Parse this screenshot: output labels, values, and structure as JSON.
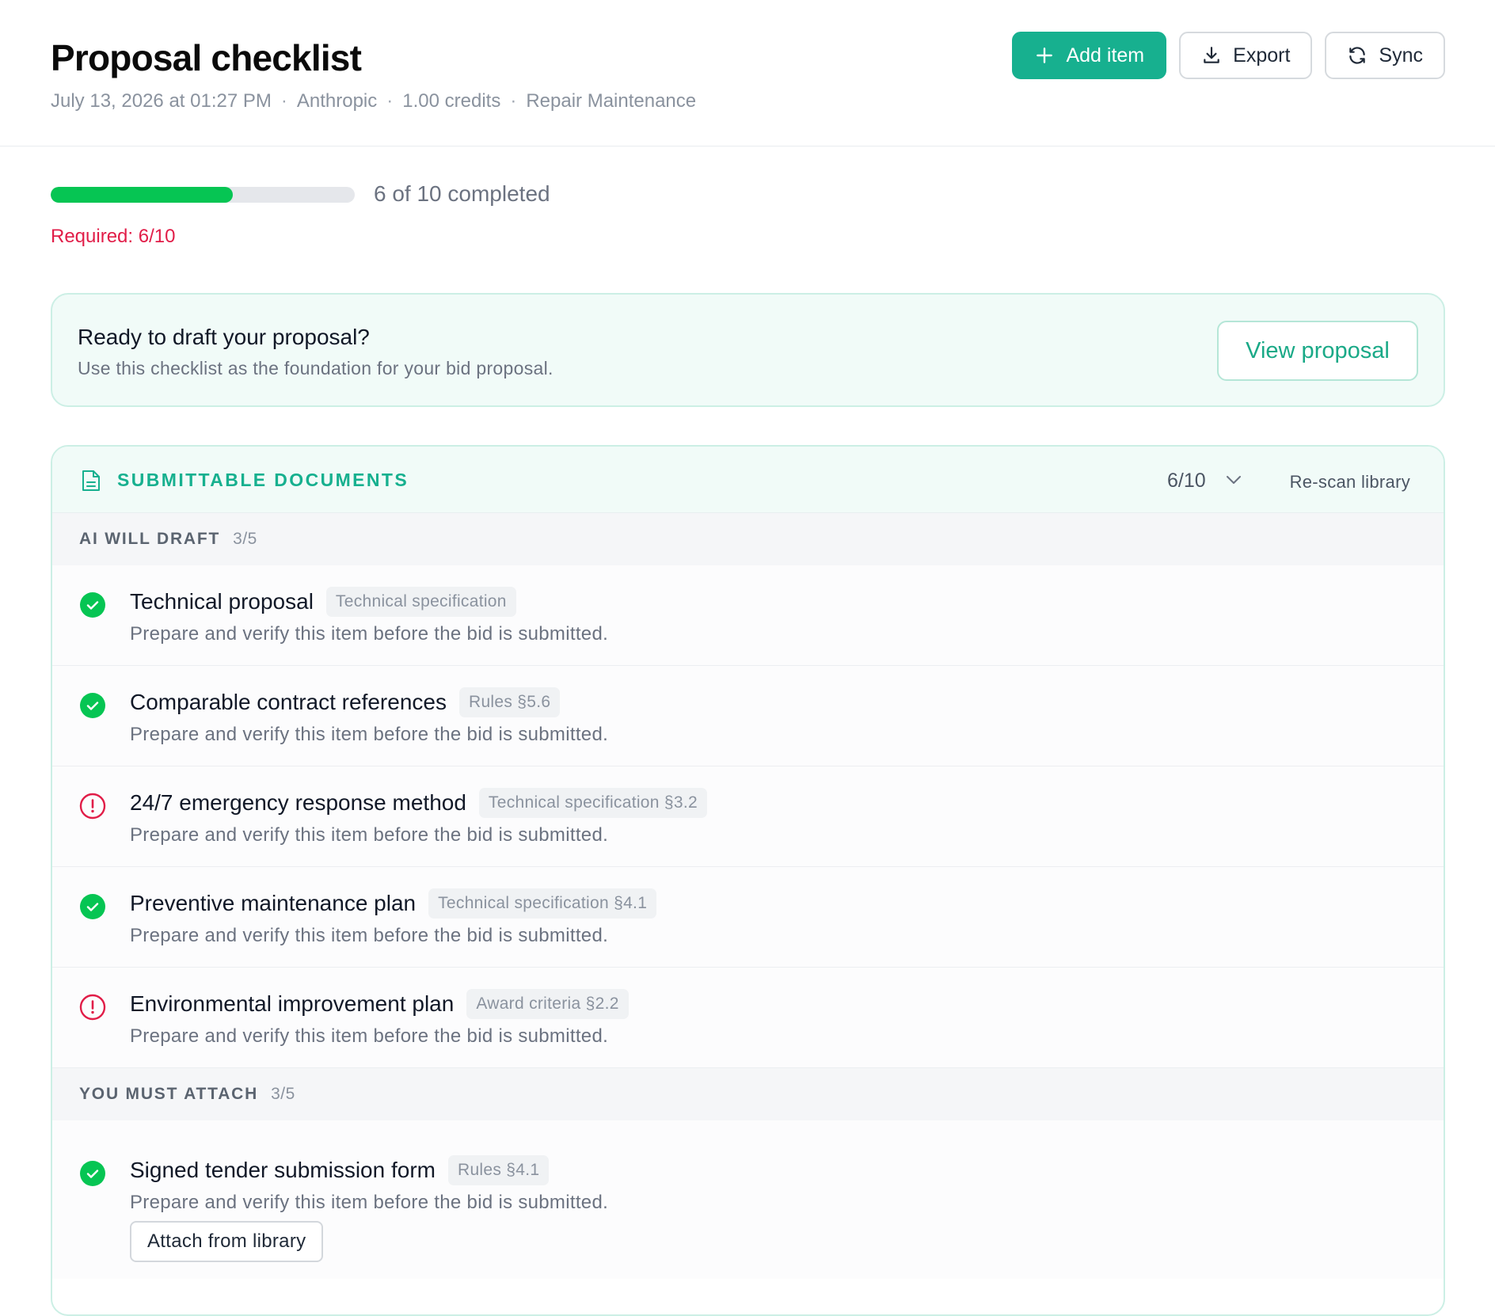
{
  "header": {
    "title": "Proposal checklist",
    "meta": [
      "July 13, 2026 at 01:27 PM",
      "Anthropic",
      "1.00 credits",
      "Repair Maintenance"
    ],
    "meta_separator": "·",
    "buttons": {
      "add_item": "Add item",
      "export": "Export",
      "sync": "Sync"
    }
  },
  "progress": {
    "completed": 6,
    "total": 10,
    "fraction": 0.6,
    "label": "6 of 10 completed",
    "required_label": "Required: 6/10"
  },
  "banner": {
    "title": "Ready to draft your proposal?",
    "subtitle": "Use this checklist as the foundation for your bid proposal.",
    "button": "View proposal"
  },
  "documents": {
    "title": "SUBMITTABLE DOCUMENTS",
    "count": "6/10",
    "rescan": "Re-scan library",
    "groups": [
      {
        "title": "AI WILL DRAFT",
        "count": "3/5",
        "items": [
          {
            "name": "Technical proposal",
            "tag": "Technical specification",
            "desc": "Prepare and verify this item before the bid is submitted.",
            "status": "complete"
          },
          {
            "name": "Comparable contract references",
            "tag": "Rules §5.6",
            "desc": "Prepare and verify this item before the bid is submitted.",
            "status": "complete"
          },
          {
            "name": "24/7 emergency response method",
            "tag": "Technical specification §3.2",
            "desc": "Prepare and verify this item before the bid is submitted.",
            "status": "warning"
          },
          {
            "name": "Preventive maintenance plan",
            "tag": "Technical specification §4.1",
            "desc": "Prepare and verify this item before the bid is submitted.",
            "status": "complete"
          },
          {
            "name": "Environmental improvement plan",
            "tag": "Award criteria §2.2",
            "desc": "Prepare and verify this item before the bid is submitted.",
            "status": "warning"
          }
        ]
      },
      {
        "title": "YOU MUST ATTACH",
        "count": "3/5",
        "items": [
          {
            "name": "Signed tender submission form",
            "tag": "Rules §4.1",
            "desc": "Prepare and verify this item before the bid is submitted.",
            "status": "complete",
            "action": "Attach from library"
          }
        ]
      }
    ]
  },
  "colors": {
    "accent": "#17b08f",
    "progress": "#06c553",
    "complete": "#06c553",
    "warning": "#e11d48",
    "required": "#e11d48"
  },
  "icons": {
    "add": "plus-icon",
    "export": "download-icon",
    "sync": "refresh-icon",
    "section": "document-icon",
    "toggle": "chevron-down-icon",
    "complete": "check-circle-icon",
    "warning": "alert-circle-icon"
  }
}
